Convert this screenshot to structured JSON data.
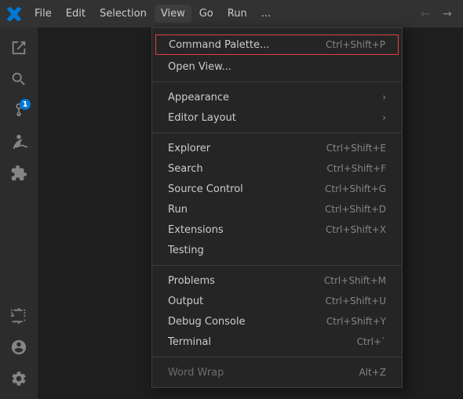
{
  "titlebar": {
    "menu_items": [
      "File",
      "Edit",
      "Selection",
      "View",
      "Go",
      "Run",
      "..."
    ],
    "active_menu": "View",
    "nav_back_disabled": true,
    "nav_forward_disabled": false
  },
  "activity_bar": {
    "icons": [
      {
        "name": "explorer-icon",
        "glyph": "files",
        "active": false
      },
      {
        "name": "search-icon",
        "glyph": "search",
        "active": false
      },
      {
        "name": "source-control-icon",
        "glyph": "git",
        "active": false,
        "badge": "1"
      },
      {
        "name": "run-debug-icon",
        "glyph": "debug",
        "active": false
      },
      {
        "name": "extensions-icon",
        "glyph": "extensions",
        "active": false
      }
    ],
    "bottom_icons": [
      {
        "name": "remote-icon",
        "glyph": "remote"
      },
      {
        "name": "accounts-icon",
        "glyph": "account"
      },
      {
        "name": "settings-icon",
        "glyph": "gear"
      }
    ]
  },
  "dropdown": {
    "sections": [
      {
        "items": [
          {
            "id": "command-palette",
            "label": "Command Palette...",
            "shortcut": "Ctrl+Shift+P",
            "highlighted": false,
            "special": true
          },
          {
            "id": "open-view",
            "label": "Open View...",
            "shortcut": "",
            "highlighted": false
          }
        ]
      },
      {
        "items": [
          {
            "id": "appearance",
            "label": "Appearance",
            "shortcut": "",
            "arrow": true
          },
          {
            "id": "editor-layout",
            "label": "Editor Layout",
            "shortcut": "",
            "arrow": true
          }
        ]
      },
      {
        "items": [
          {
            "id": "explorer",
            "label": "Explorer",
            "shortcut": "Ctrl+Shift+E"
          },
          {
            "id": "search",
            "label": "Search",
            "shortcut": "Ctrl+Shift+F"
          },
          {
            "id": "source-control",
            "label": "Source Control",
            "shortcut": "Ctrl+Shift+G"
          },
          {
            "id": "run",
            "label": "Run",
            "shortcut": "Ctrl+Shift+D"
          },
          {
            "id": "extensions",
            "label": "Extensions",
            "shortcut": "Ctrl+Shift+X"
          },
          {
            "id": "testing",
            "label": "Testing",
            "shortcut": ""
          }
        ]
      },
      {
        "items": [
          {
            "id": "problems",
            "label": "Problems",
            "shortcut": "Ctrl+Shift+M"
          },
          {
            "id": "output",
            "label": "Output",
            "shortcut": "Ctrl+Shift+U"
          },
          {
            "id": "debug-console",
            "label": "Debug Console",
            "shortcut": "Ctrl+Shift+Y"
          },
          {
            "id": "terminal",
            "label": "Terminal",
            "shortcut": "Ctrl+`"
          }
        ]
      },
      {
        "items": [
          {
            "id": "word-wrap",
            "label": "Word Wrap",
            "shortcut": "Alt+Z",
            "disabled": true
          }
        ]
      }
    ]
  },
  "colors": {
    "active_menu_bg": "#3d3d3d",
    "dropdown_bg": "#252526",
    "highlight_bg": "#094771",
    "border": "#3c3c3c",
    "command_palette_border": "#e04040",
    "badge_bg": "#0078d4"
  }
}
